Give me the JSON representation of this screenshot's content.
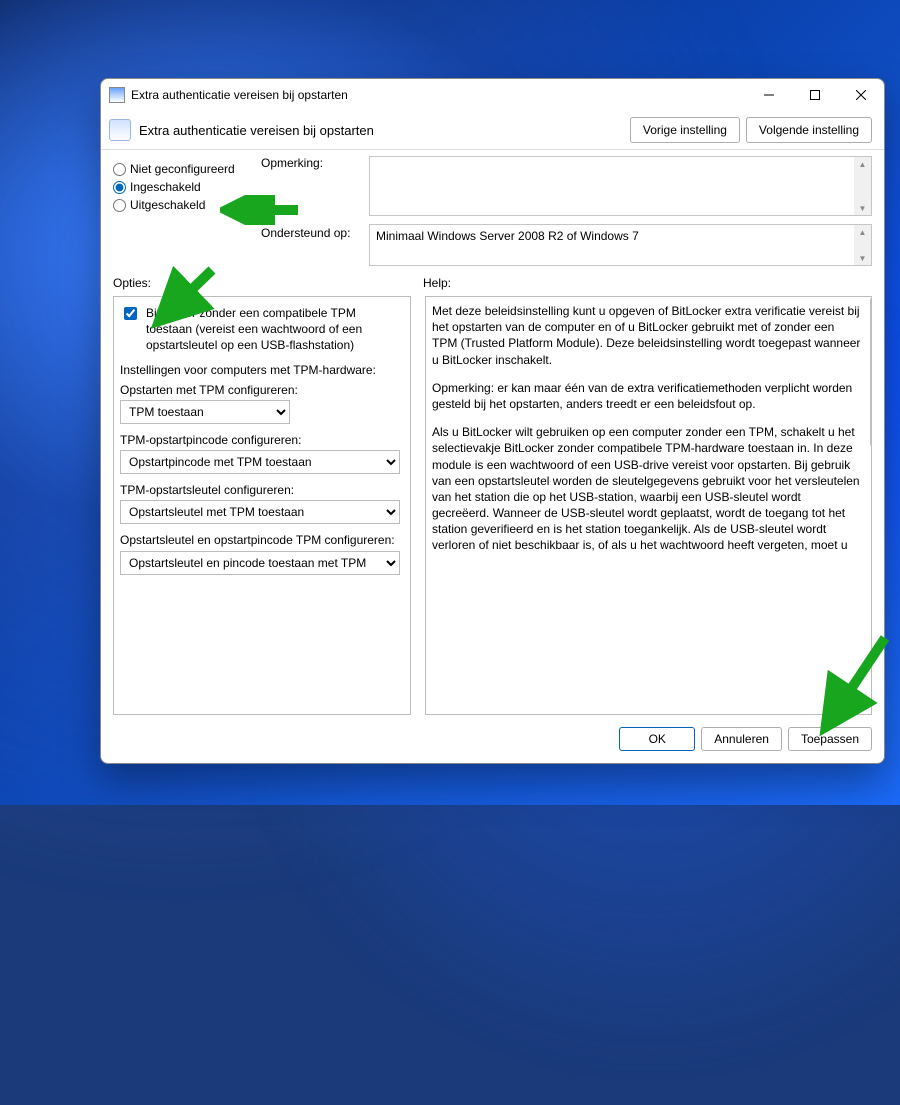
{
  "window": {
    "title": "Extra authenticatie vereisen bij opstarten"
  },
  "header": {
    "title": "Extra authenticatie vereisen bij opstarten",
    "prev_btn": "Vorige instelling",
    "next_btn": "Volgende instelling"
  },
  "state": {
    "not_configured": "Niet geconfigureerd",
    "enabled": "Ingeschakeld",
    "disabled": "Uitgeschakeld"
  },
  "meta": {
    "comment_label": "Opmerking:",
    "comment_value": "",
    "supported_label": "Ondersteund op:",
    "supported_value": "Minimaal Windows Server 2008 R2 of Windows 7"
  },
  "columns": {
    "options_label": "Opties:",
    "help_label": "Help:"
  },
  "options": {
    "chk_label": "BitLocker zonder een compatibele TPM toestaan (vereist een wachtwoord of een opstartsleutel op een USB-flashstation)",
    "section_hdr": "Instellingen voor computers met TPM-hardware:",
    "tpm_startup_label": "Opstarten met TPM configureren:",
    "tpm_startup_value": "TPM toestaan",
    "tpm_pin_label": "TPM-opstartpincode configureren:",
    "tpm_pin_value": "Opstartpincode met TPM toestaan",
    "tpm_key_label": "TPM-opstartsleutel configureren:",
    "tpm_key_value": "Opstartsleutel met TPM toestaan",
    "tpm_keypin_label": "Opstartsleutel en opstartpincode TPM configureren:",
    "tpm_keypin_value": "Opstartsleutel en pincode toestaan met TPM"
  },
  "help": {
    "p1": "Met deze beleidsinstelling kunt u opgeven of BitLocker extra verificatie vereist bij het opstarten van de computer en of u BitLocker gebruikt met of zonder een TPM (Trusted Platform Module). Deze beleidsinstelling wordt toegepast wanneer u BitLocker inschakelt.",
    "p2": "Opmerking: er kan maar één van de extra verificatiemethoden verplicht worden gesteld bij het opstarten, anders treedt er een beleidsfout op.",
    "p3": "Als u BitLocker wilt gebruiken op een computer zonder een TPM, schakelt u het selectievakje BitLocker zonder compatibele TPM-hardware toestaan in. In deze module is een wachtwoord of een USB-drive vereist voor opstarten. Bij gebruik van een opstartsleutel worden de sleutelgegevens gebruikt voor het versleutelen van het station die op het USB-station, waarbij een USB-sleutel wordt gecreëerd. Wanneer de USB-sleutel wordt geplaatst, wordt de toegang tot het station geverifieerd en is het station toegankelijk. Als de USB-sleutel wordt verloren of niet beschikbaar is, of als u het wachtwoord heeft vergeten, moet u"
  },
  "buttons": {
    "ok": "OK",
    "cancel": "Annuleren",
    "apply": "Toepassen"
  }
}
